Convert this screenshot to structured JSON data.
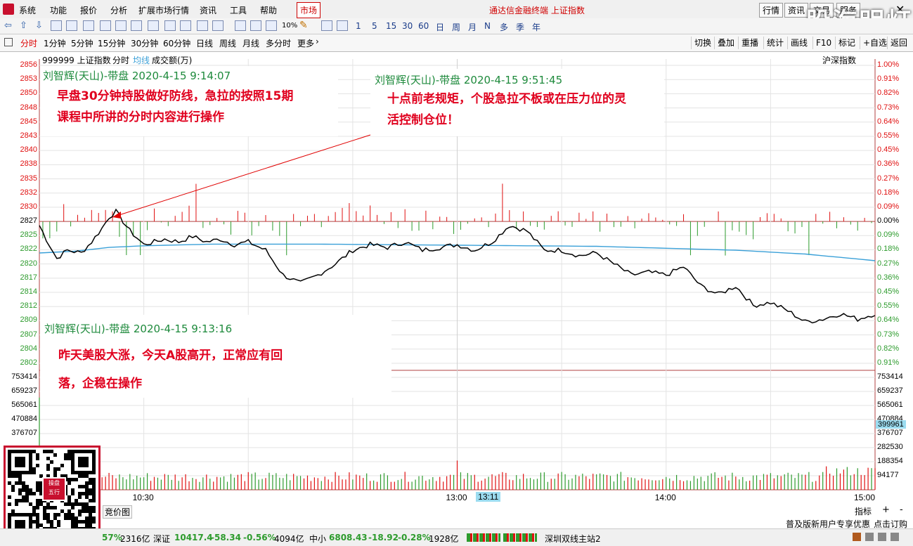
{
  "menu": {
    "items": [
      "系统",
      "功能",
      "报价",
      "分析",
      "扩展市场行情",
      "资讯",
      "工具",
      "帮助"
    ],
    "market_tab": "市场",
    "title": "通达信金融终端 上证指数",
    "right_buttons": [
      "行情",
      "资讯",
      "交易",
      "服务"
    ],
    "watermark": "股海明灯"
  },
  "toolbar": {
    "period_items": [
      "1",
      "5",
      "15",
      "30",
      "60",
      "日",
      "周",
      "月",
      "N",
      "多",
      "季",
      "年"
    ],
    "ten_label": "10%"
  },
  "tabs": {
    "items": [
      "分时",
      "1分钟",
      "5分钟",
      "15分钟",
      "30分钟",
      "60分钟",
      "日线",
      "周线",
      "月线",
      "多分时",
      "更多"
    ],
    "right_items": [
      "切换",
      "叠加",
      "重播",
      "统计",
      "画线",
      "F10",
      "标记",
      "+自选",
      "返回"
    ]
  },
  "chart_header": {
    "code_name": "999999 上证指数",
    "mode": "分时",
    "avg_label": "均线",
    "volume_label": "成交额(万)",
    "right_label": "沪深指数"
  },
  "chart_data": {
    "type": "line",
    "price_ticks": [
      "2856",
      "2853",
      "2850",
      "2848",
      "2845",
      "2843",
      "2840",
      "2838",
      "2835",
      "2832",
      "2830",
      "2827",
      "2825",
      "2822",
      "2820",
      "2817",
      "2814",
      "2812",
      "2809",
      "2807",
      "2804",
      "2802"
    ],
    "pct_ticks": [
      "1.00%",
      "0.91%",
      "0.82%",
      "0.73%",
      "0.64%",
      "0.55%",
      "0.45%",
      "0.36%",
      "0.27%",
      "0.18%",
      "0.09%",
      "0.00%",
      "0.09%",
      "0.18%",
      "0.27%",
      "0.36%",
      "0.45%",
      "0.55%",
      "0.64%",
      "0.73%",
      "0.82%",
      "0.91%"
    ],
    "volume_ticks_left": [
      "753414",
      "659237",
      "565061",
      "470884",
      "376707"
    ],
    "volume_ticks_right": [
      "753414",
      "659237",
      "565061",
      "470884",
      "376707",
      "282530",
      "188354",
      "94177"
    ],
    "volume_highlight": "399961",
    "time_ticks": [
      "10:30",
      "13:00",
      "14:00",
      "15:00"
    ],
    "time_highlight": "13:11",
    "price_series": {
      "name": "",
      "x": [
        0,
        2,
        5,
        8,
        12,
        15,
        18,
        20,
        22,
        26,
        30,
        33,
        36,
        40,
        44,
        48,
        52,
        56,
        60,
        65,
        70,
        75,
        80,
        85,
        90,
        95,
        100,
        105,
        110,
        115,
        120,
        125,
        130,
        135,
        140,
        145,
        150,
        155,
        160,
        165,
        170,
        175,
        180,
        185,
        190,
        195,
        200,
        205,
        210,
        215,
        220,
        225,
        230,
        235,
        240
      ],
      "y": [
        2827.0,
        2824.5,
        2821.0,
        2822.5,
        2822.0,
        2824.0,
        2826.5,
        2828.5,
        2829.5,
        2826.0,
        2823.5,
        2824.0,
        2824.5,
        2824.0,
        2825.0,
        2824.0,
        2824.5,
        2823.5,
        2824.0,
        2822.5,
        2818.0,
        2816.5,
        2818.0,
        2820.0,
        2822.5,
        2823.5,
        2823.0,
        2824.0,
        2822.5,
        2823.0,
        2823.5,
        2822.5,
        2824.0,
        2827.0,
        2826.0,
        2822.5,
        2822.5,
        2821.5,
        2822.0,
        2820.0,
        2818.0,
        2818.5,
        2818.0,
        2819.5,
        2816.0,
        2814.5,
        2816.0,
        2812.5,
        2813.0,
        2811.5,
        2809.5,
        2810.0,
        2811.0,
        2810.0,
        2811.0
      ]
    },
    "avg_series": {
      "name": "",
      "x": [
        0,
        10,
        20,
        30,
        50,
        80,
        120,
        160,
        200,
        220,
        240
      ],
      "y": [
        2822.0,
        2822.3,
        2823.0,
        2823.3,
        2823.6,
        2823.6,
        2823.4,
        2823.2,
        2822.5,
        2821.8,
        2820.6
      ]
    },
    "ylim": [
      2802,
      2856
    ],
    "volume_max": 753414
  },
  "annotations": [
    {
      "header": "刘智辉(天山)-带盘 2020-4-15 9:14:07",
      "lines": [
        "早盘30分钟持股做好防线，急拉的按照15期",
        "课程中所讲的分时内容进行操作"
      ]
    },
    {
      "header": "刘智辉(天山)-带盘 2020-4-15 9:51:45",
      "lines": [
        "十点前老规矩，个股急拉不板或在压力位的灵",
        "活控制仓位！"
      ]
    },
    {
      "header": "刘智辉(天山)-带盘 2020-4-15 9:13:16",
      "lines": [
        "昨天美股大涨，今天A股高开，正常应有回",
        "落，企稳在操作"
      ]
    }
  ],
  "qr": {
    "badge_top": "操盘",
    "badge_right": "五行"
  },
  "bottom": {
    "auction_label": "竞价图",
    "indicator_label": "指标",
    "plus": "+",
    "minus": "-",
    "promo": "普及版新用户专享优惠",
    "subscribe": "点击订购"
  },
  "status": {
    "sh_tail": "57%",
    "sh_amt": "2316亿",
    "sz_name": "深证",
    "sz_val": "10417.4",
    "sz_chg": "-58.34",
    "sz_pct": "-0.56%",
    "sz_amt": "4094亿",
    "zx_name": "中小",
    "zx_val": "6808.43",
    "zx_chg": "-18.92",
    "zx_pct": "-0.28%",
    "zx_amt": "1928亿",
    "station": "深圳双线主站2"
  },
  "colors": {
    "up": "#e01010",
    "down": "#2d9b2d",
    "avg": "#3aa0d8",
    "price": "#000000",
    "label_red": "#e0001e",
    "label_green": "#1e8a3c"
  }
}
